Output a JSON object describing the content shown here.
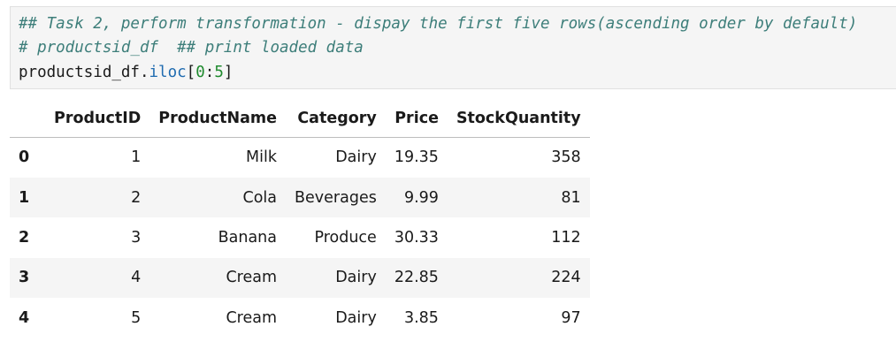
{
  "code_cell": {
    "line1": "## Task 2, perform transformation - dispay the first five rows(ascending order by default)",
    "line2": "# productsid_df  ## print loaded data",
    "line3": {
      "name": "productsid_df",
      "dot": ".",
      "attr": "iloc",
      "open": "[",
      "start": "0",
      "colon": ":",
      "end": "5",
      "close": "]"
    }
  },
  "dataframe": {
    "columns": [
      "ProductID",
      "ProductName",
      "Category",
      "Price",
      "StockQuantity"
    ],
    "rows": [
      {
        "index": "0",
        "cells": [
          "1",
          "Milk",
          "Dairy",
          "19.35",
          "358"
        ]
      },
      {
        "index": "1",
        "cells": [
          "2",
          "Cola",
          "Beverages",
          "9.99",
          "81"
        ]
      },
      {
        "index": "2",
        "cells": [
          "3",
          "Banana",
          "Produce",
          "30.33",
          "112"
        ]
      },
      {
        "index": "3",
        "cells": [
          "4",
          "Cream",
          "Dairy",
          "22.85",
          "224"
        ]
      },
      {
        "index": "4",
        "cells": [
          "5",
          "Cream",
          "Dairy",
          "3.85",
          "97"
        ]
      }
    ]
  }
}
